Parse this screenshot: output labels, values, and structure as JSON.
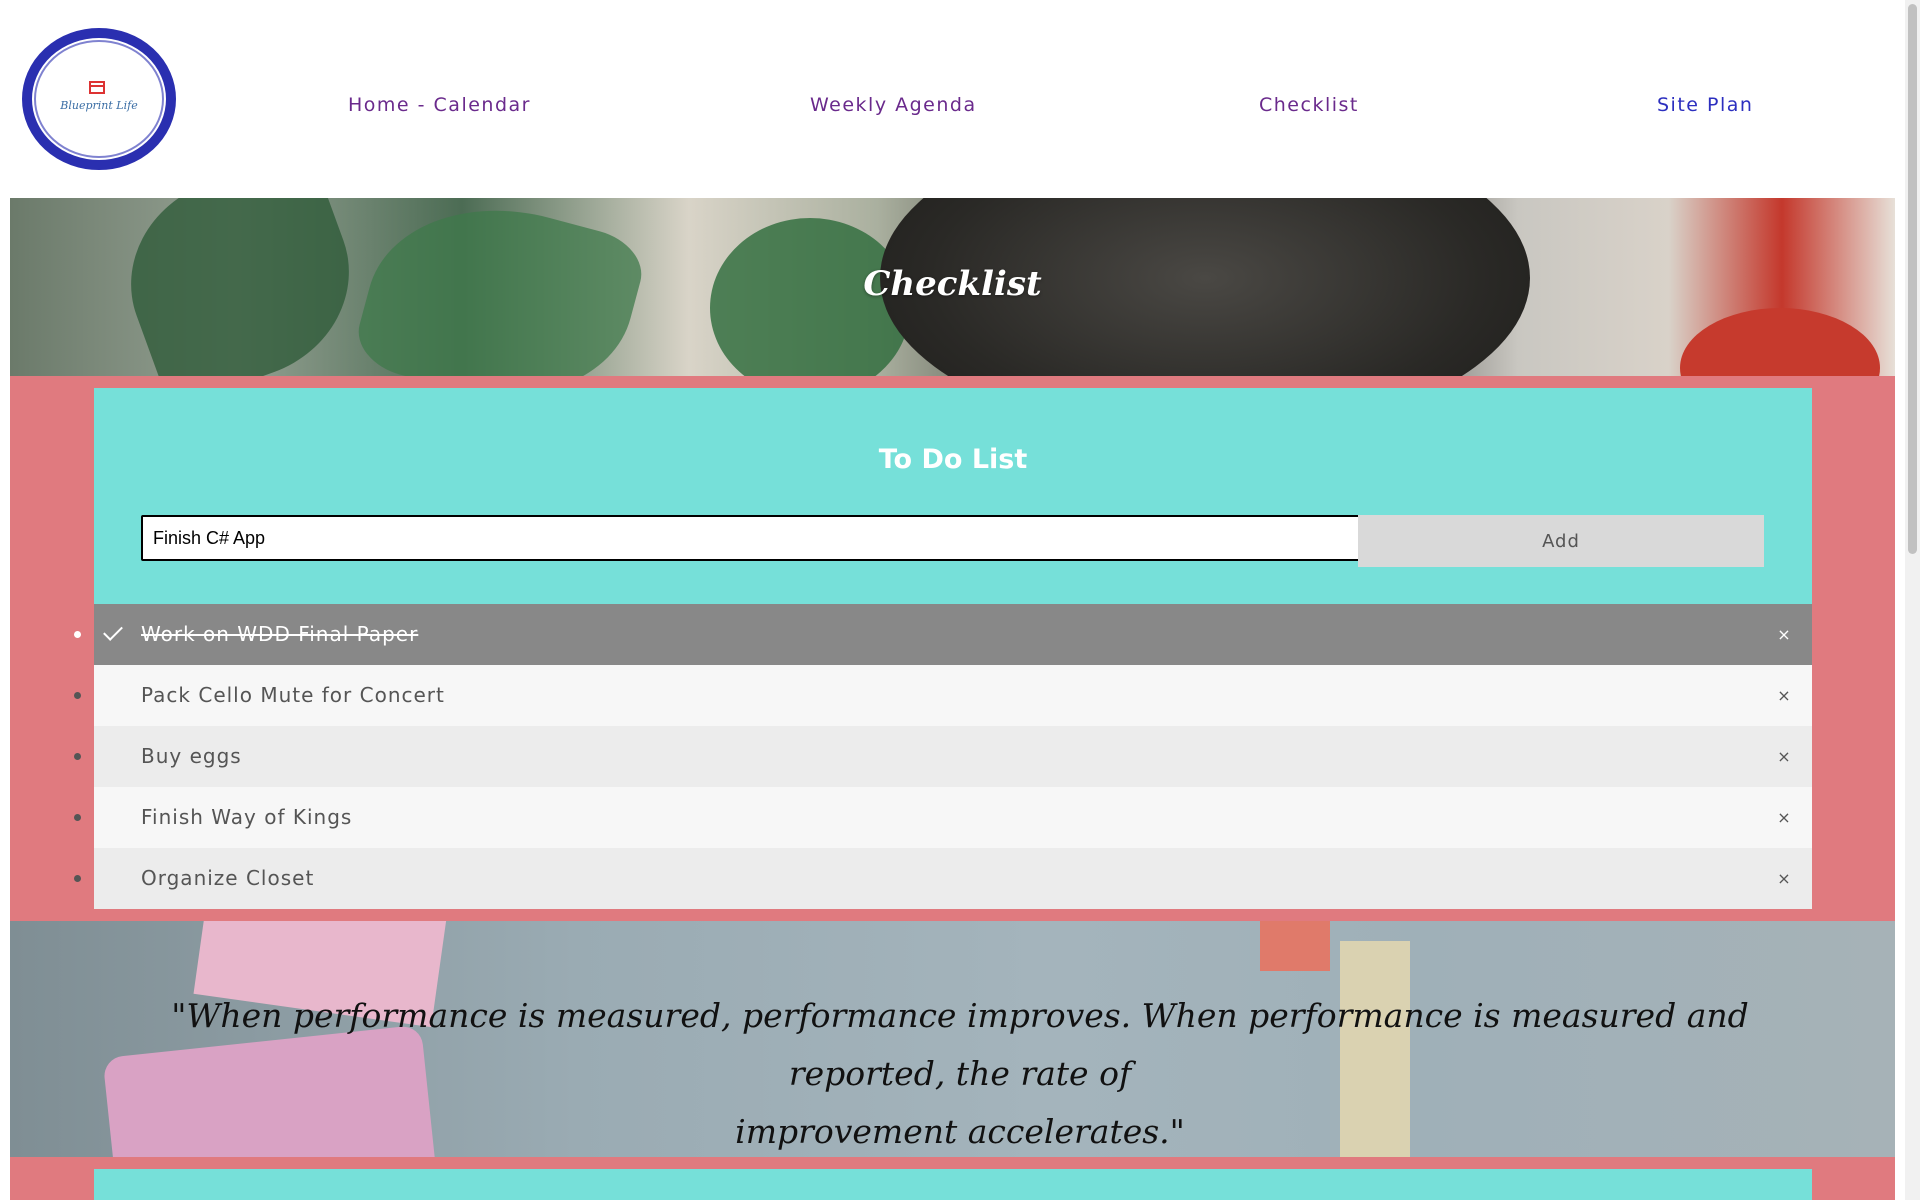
{
  "logo": {
    "text": "Blueprint Life"
  },
  "nav": {
    "home": "Home - Calendar",
    "weekly": "Weekly Agenda",
    "checklist": "Checklist",
    "siteplan": "Site Plan"
  },
  "hero": {
    "title": "Checklist"
  },
  "todo": {
    "title": "To Do List",
    "input_value": "Finish C# App",
    "add_label": "Add",
    "close_symbol": "×",
    "items": [
      {
        "label": "Work on WDD Final Paper",
        "checked": true
      },
      {
        "label": "Pack Cello Mute for Concert",
        "checked": false
      },
      {
        "label": "Buy eggs",
        "checked": false
      },
      {
        "label": "Finish Way of Kings",
        "checked": false
      },
      {
        "label": "Organize Closet",
        "checked": false
      }
    ]
  },
  "quote": {
    "line1": "\"When performance is measured, performance improves. When performance is measured and reported, the rate of",
    "line2": "improvement accelerates.\""
  },
  "colors": {
    "pink_band": "#e07a7f",
    "teal_panel": "#76e0d9",
    "nav_purple": "#6a2a8c",
    "nav_blue": "#2c2fbf",
    "checked_item": "#888888",
    "logo_ring": "#2a2fb0"
  }
}
